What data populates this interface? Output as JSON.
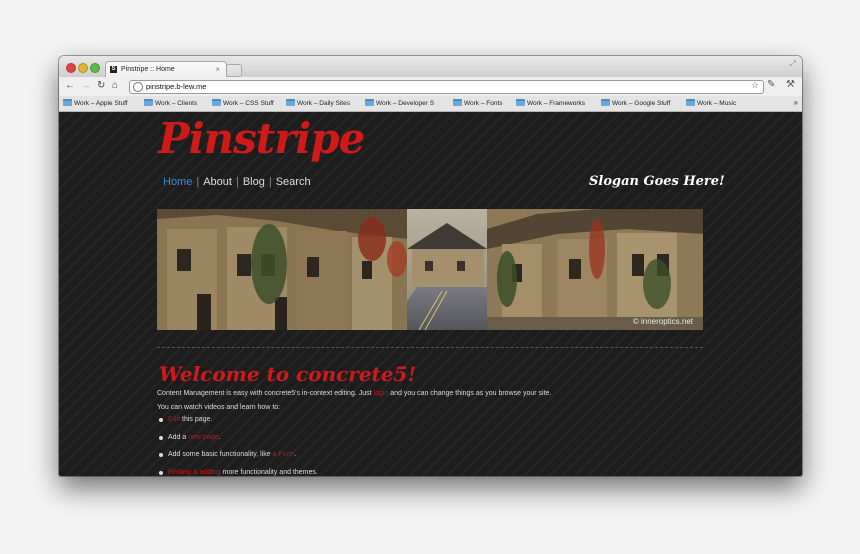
{
  "browser": {
    "tab_title": "Pinstripe :: Home",
    "tab_favicon": "S",
    "tab_close": "×",
    "url": "pinstripe.b-lew.me",
    "nav_icons": [
      "back-icon",
      "forward-icon",
      "reload-icon",
      "home-icon"
    ],
    "toolbar_icons": [
      "bookmark-star-icon",
      "extension-icon",
      "wrench-icon"
    ],
    "bookmarks": [
      "Work – Apple Stuff",
      "Work – Clients",
      "Work – CSS Stuff",
      "Work – Daily Sites",
      "Work – Developer S",
      "Work – Fonts",
      "Work – Frameworks",
      "Work – Google Stuff",
      "Work – Music"
    ],
    "bookmarks_overflow": "»"
  },
  "site": {
    "logo": "Pinstripe",
    "nav": [
      "Home",
      "About",
      "Blog",
      "Search"
    ],
    "slogan": "Slogan Goes Here!",
    "hero_credit": "© inneroptics.net",
    "welcome": "Welcome to concrete5!",
    "intro": {
      "before": "Content Management is easy with concrete5's in-context editing. Just ",
      "link": "login",
      "after": " and you can change things as you browse your site."
    },
    "videos_line": "You can watch videos and learn how to:",
    "bullets": [
      {
        "link": "Edit",
        "after": " this page."
      },
      {
        "before": "Add a ",
        "link": "new page",
        "after": "."
      },
      {
        "before": "Add some basic functionality, like ",
        "link": "a Form",
        "after": "."
      },
      {
        "link": "Finding & adding",
        "after": " more functionality and themes."
      }
    ]
  },
  "colors": {
    "accent_red": "#d01a1a",
    "nav_active": "#3d8bd8",
    "page_bg": "#1d1d1d"
  }
}
